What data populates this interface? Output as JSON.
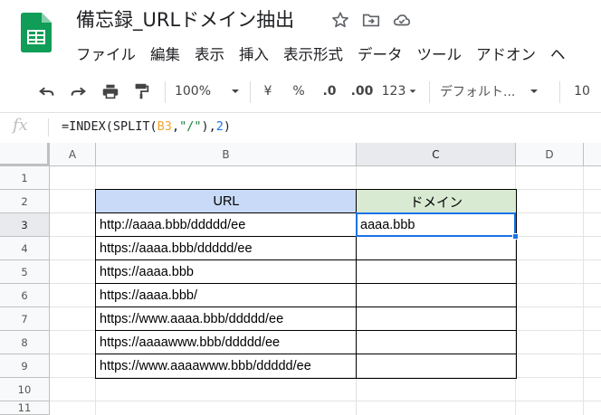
{
  "app": {
    "title": "備忘録_URLドメイン抽出",
    "menu": [
      "ファイル",
      "編集",
      "表示",
      "挿入",
      "表示形式",
      "データ",
      "ツール",
      "アドオン",
      "ヘ"
    ]
  },
  "toolbar": {
    "zoom": "100%",
    "currency": "¥",
    "percent": "%",
    "decrease_decimal": ".0",
    "increase_decimal": ".00",
    "number_format": "123",
    "font": "デフォルト...",
    "font_size": "10"
  },
  "formula_bar": {
    "fx_label": "fx",
    "prefix": "=INDEX(SPLIT(",
    "ref": "B3",
    "comma1": ",",
    "string": "\"/\"",
    "middle": "),",
    "number": "2",
    "suffix": ")"
  },
  "grid": {
    "columns": [
      "A",
      "B",
      "C",
      "D"
    ],
    "rows": [
      "1",
      "2",
      "3",
      "4",
      "5",
      "6",
      "7",
      "8",
      "9",
      "10",
      "11"
    ],
    "active_cell": "C3"
  },
  "table": {
    "headers": [
      "URL",
      "ドメイン"
    ],
    "urls": [
      "http://aaaa.bbb/ddddd/ee",
      "https://aaaa.bbb/ddddd/ee",
      "https://aaaa.bbb",
      "https://aaaa.bbb/",
      "https://www.aaaa.bbb/ddddd/ee",
      "https://aaaawww.bbb/ddddd/ee",
      "https://www.aaaawww.bbb/ddddd/ee"
    ],
    "domains": [
      "aaaa.bbb",
      "",
      "",
      "",
      "",
      "",
      ""
    ]
  },
  "colors": {
    "url_header_bg": "#c9daf8",
    "domain_header_bg": "#d9ead3",
    "selection": "#1a73e8",
    "sheets_green": "#0f9d58"
  },
  "icons": {
    "star": "star-icon",
    "move": "move-to-folder-icon",
    "cloud": "cloud-status-icon",
    "undo": "undo-icon",
    "redo": "redo-icon",
    "print": "print-icon",
    "paint": "paint-format-icon"
  }
}
